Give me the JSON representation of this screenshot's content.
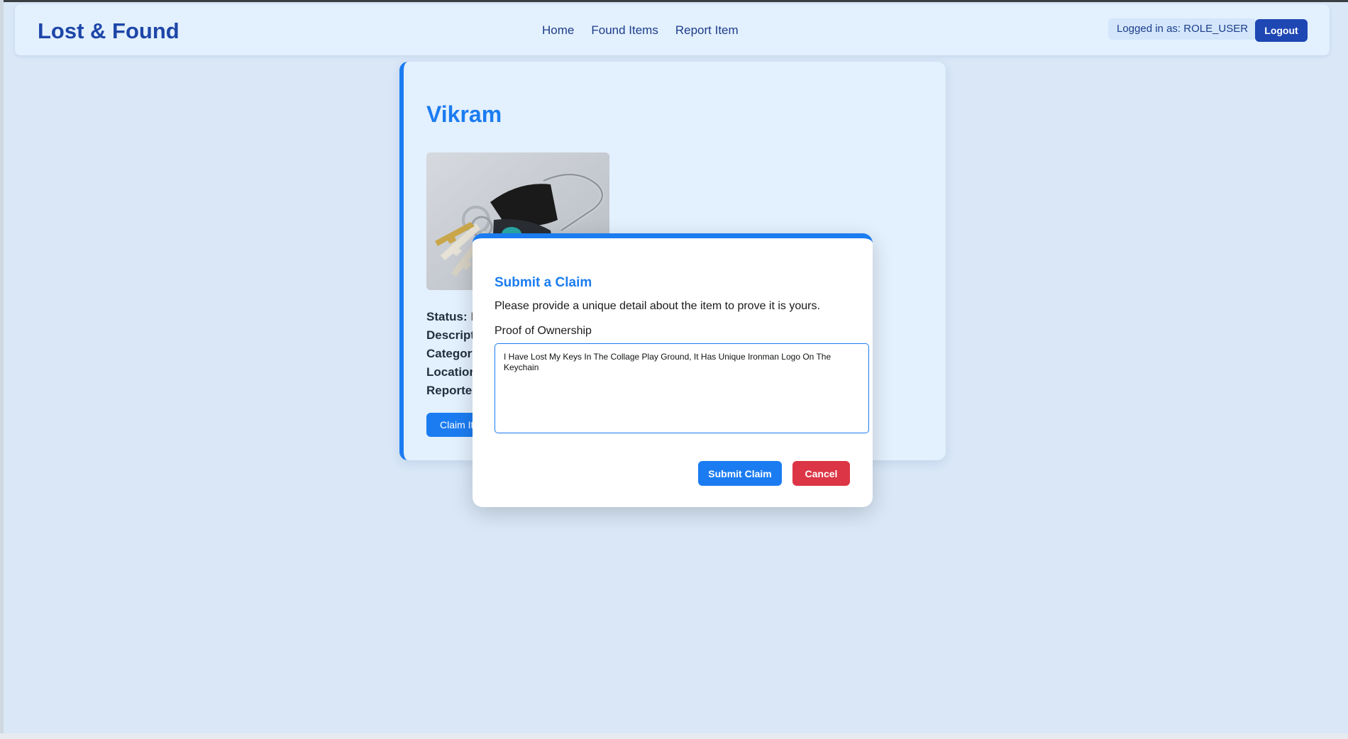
{
  "navbar": {
    "brand": "Lost & Found",
    "links": [
      "Home",
      "Found Items",
      "Report Item"
    ],
    "logged_in_text": "Logged in as: ROLE_USER",
    "logout_label": "Logout"
  },
  "item": {
    "title": "Vikram",
    "image_icon": "keys-photo",
    "details": [
      {
        "label": "Status:",
        "value": "F"
      },
      {
        "label": "Descript",
        "value": ""
      },
      {
        "label": "Category",
        "value": ""
      },
      {
        "label": "Location",
        "value": ""
      },
      {
        "label": "Reportec",
        "value": ""
      }
    ],
    "claim_button_label": "Claim It"
  },
  "modal": {
    "title": "Submit a Claim",
    "description": "Please provide a unique detail about the item to prove it is yours.",
    "proof_label": "Proof of Ownership",
    "proof_value": "I Have Lost My Keys In The Collage Play Ground, It Has Unique Ironman Logo On The Keychain",
    "submit_label": "Submit Claim",
    "cancel_label": "Cancel"
  },
  "colors": {
    "accent": "#1b7cf1",
    "brand": "#1d46a8",
    "danger": "#dc3545",
    "background": "#d9e7f7"
  }
}
